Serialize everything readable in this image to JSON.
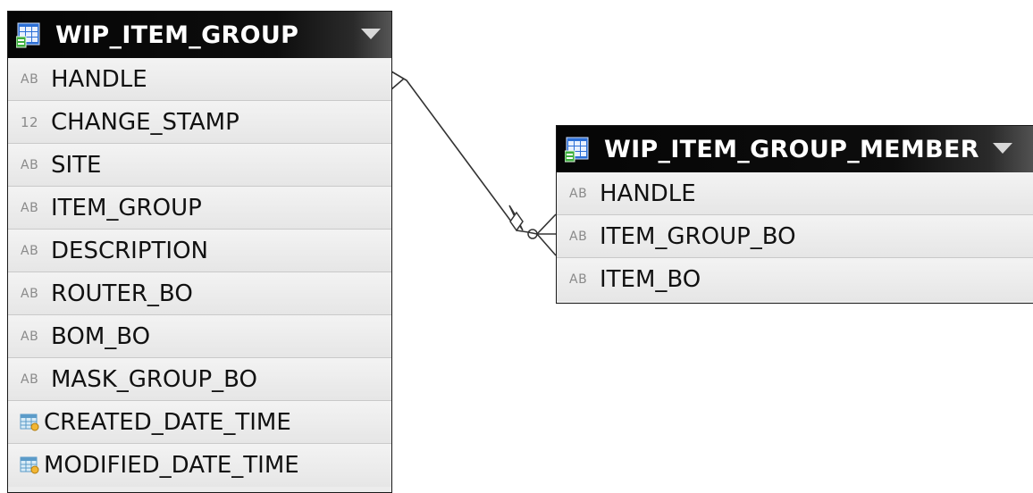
{
  "entities": [
    {
      "name": "WIP_ITEM_GROUP",
      "columns": [
        {
          "type": "text",
          "type_label": "AB",
          "name": "HANDLE"
        },
        {
          "type": "number",
          "type_label": "12",
          "name": "CHANGE_STAMP"
        },
        {
          "type": "text",
          "type_label": "AB",
          "name": "SITE"
        },
        {
          "type": "text",
          "type_label": "AB",
          "name": "ITEM_GROUP"
        },
        {
          "type": "text",
          "type_label": "AB",
          "name": "DESCRIPTION"
        },
        {
          "type": "text",
          "type_label": "AB",
          "name": "ROUTER_BO"
        },
        {
          "type": "text",
          "type_label": "AB",
          "name": "BOM_BO"
        },
        {
          "type": "text",
          "type_label": "AB",
          "name": "MASK_GROUP_BO"
        },
        {
          "type": "datetime",
          "type_label": "",
          "name": "CREATED_DATE_TIME"
        },
        {
          "type": "datetime",
          "type_label": "",
          "name": "MODIFIED_DATE_TIME"
        }
      ]
    },
    {
      "name": "WIP_ITEM_GROUP_MEMBER",
      "columns": [
        {
          "type": "text",
          "type_label": "AB",
          "name": "HANDLE"
        },
        {
          "type": "text",
          "type_label": "AB",
          "name": "ITEM_GROUP_BO"
        },
        {
          "type": "text",
          "type_label": "AB",
          "name": "ITEM_BO"
        }
      ]
    }
  ],
  "relationship": {
    "from": "WIP_ITEM_GROUP.HANDLE",
    "to": "WIP_ITEM_GROUP_MEMBER.ITEM_GROUP_BO",
    "type": "one-to-many"
  },
  "icons": {
    "table": "table-icon",
    "text_column": "text-type-icon",
    "number_column": "number-type-icon",
    "datetime_column": "calendar-icon",
    "menu": "chevron-down-icon"
  },
  "colors": {
    "header_bg": "#0a0a0a",
    "header_text": "#ffffff",
    "row_bg": "#ececec",
    "type_icon": "#8a8a8a"
  }
}
